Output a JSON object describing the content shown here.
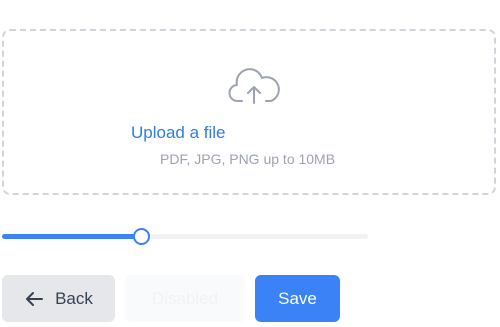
{
  "upload": {
    "link_label": "Upload a file",
    "hint": "PDF, JPG, PNG up to 10MB",
    "icon": "cloud-upload-icon"
  },
  "slider": {
    "value_percent": 38
  },
  "buttons": {
    "back_label": "Back",
    "back_icon": "arrow-left-icon",
    "disabled_label": "Disabled",
    "save_label": "Save"
  },
  "colors": {
    "accent": "#3b82f6",
    "link": "#2f7de1",
    "muted_text": "#9ca3af",
    "dashed_border": "#d1d5db",
    "secondary_button": "#e5e7eb"
  }
}
